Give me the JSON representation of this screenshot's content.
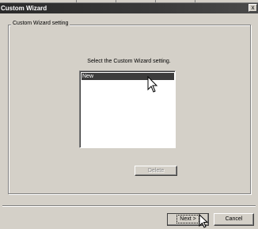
{
  "window": {
    "title": "Custom Wizard",
    "close_label": "x"
  },
  "group": {
    "legend": "Custom Wizard setting"
  },
  "prompt": "Select the Custom Wizard setting.",
  "list": {
    "items": [
      {
        "label": "New",
        "selected": true
      }
    ]
  },
  "buttons": {
    "delete": "Delete",
    "next": "Next >",
    "cancel": "Cancel"
  },
  "colors": {
    "face": "#d4d0c8",
    "titlebar": "#333333",
    "selection": "#3c3c3c",
    "disabled_text": "#8a8a8a"
  }
}
